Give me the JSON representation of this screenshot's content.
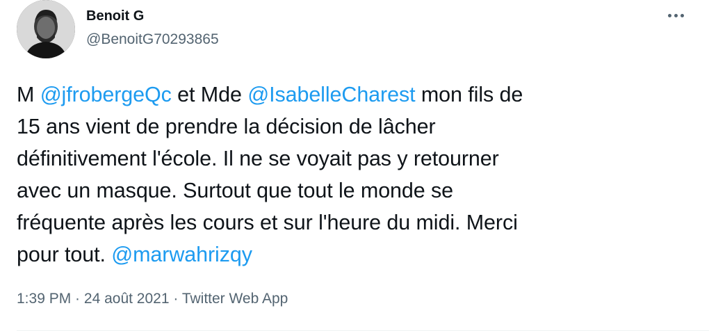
{
  "author": {
    "display_name": "Benoit G",
    "handle": "@BenoitG70293865",
    "avatar_icon": "profile-photo"
  },
  "more_icon": "more-horizontal-icon",
  "tweet": {
    "lines": [
      [
        {
          "type": "text",
          "text": "M "
        },
        {
          "type": "mention",
          "text": "@jfrobergeQc"
        },
        {
          "type": "text",
          "text": " et Mde "
        },
        {
          "type": "mention",
          "text": "@IsabelleCharest"
        },
        {
          "type": "text",
          "text": " mon fils de"
        }
      ],
      [
        {
          "type": "text",
          "text": "15 ans vient de prendre la décision de lâcher"
        }
      ],
      [
        {
          "type": "text",
          "text": "définitivement l'école. Il ne se voyait pas y retourner"
        }
      ],
      [
        {
          "type": "text",
          "text": "avec un masque. Surtout que tout le monde se"
        }
      ],
      [
        {
          "type": "text",
          "text": "fréquente après les cours et sur l'heure du midi. Merci"
        }
      ],
      [
        {
          "type": "text",
          "text": "pour tout. "
        },
        {
          "type": "mention",
          "text": "@marwahrizqy"
        }
      ]
    ]
  },
  "meta": {
    "time": "1:39 PM",
    "sep1": " · ",
    "date": "24 août 2021",
    "sep2": " · ",
    "source": "Twitter Web App"
  },
  "colors": {
    "mention": "#1d9bf0",
    "secondary": "#536471",
    "text": "#0f1419"
  }
}
